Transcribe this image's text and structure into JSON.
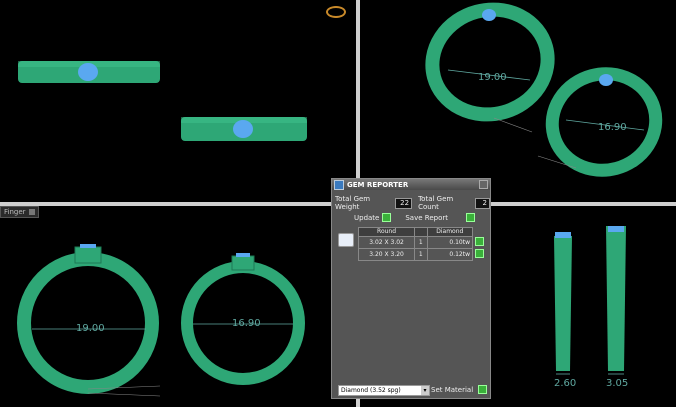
{
  "viewports": {
    "active_label": "Finger",
    "front": {},
    "perspective": {
      "dim1": "19.00",
      "dim2": "16.90"
    },
    "top": {
      "dim1": "19.00",
      "dim2": "16.90"
    },
    "side": {
      "dim1": "2.60",
      "dim2": "3.05"
    }
  },
  "gem_reporter": {
    "title": "GEM REPORTER",
    "total_weight_label": "Total Gem Weight",
    "total_weight_value": "22",
    "total_count_label": "Total Gem Count",
    "total_count_value": "2",
    "update_label": "Update",
    "save_report_label": "Save Report",
    "table": {
      "headers": [
        "Round",
        "Diamond"
      ],
      "rows": [
        {
          "size": "3.02 X 3.02",
          "count": "1",
          "weight": "0.10tw"
        },
        {
          "size": "3.20 X 3.20",
          "count": "1",
          "weight": "0.12tw"
        }
      ]
    },
    "material_value": "Diamond   (3.52 spg)",
    "set_material_label": "Set Material"
  },
  "colors": {
    "ring": "#2ea776",
    "gem": "#5aa8f0",
    "dim": "#5fa8a0"
  }
}
